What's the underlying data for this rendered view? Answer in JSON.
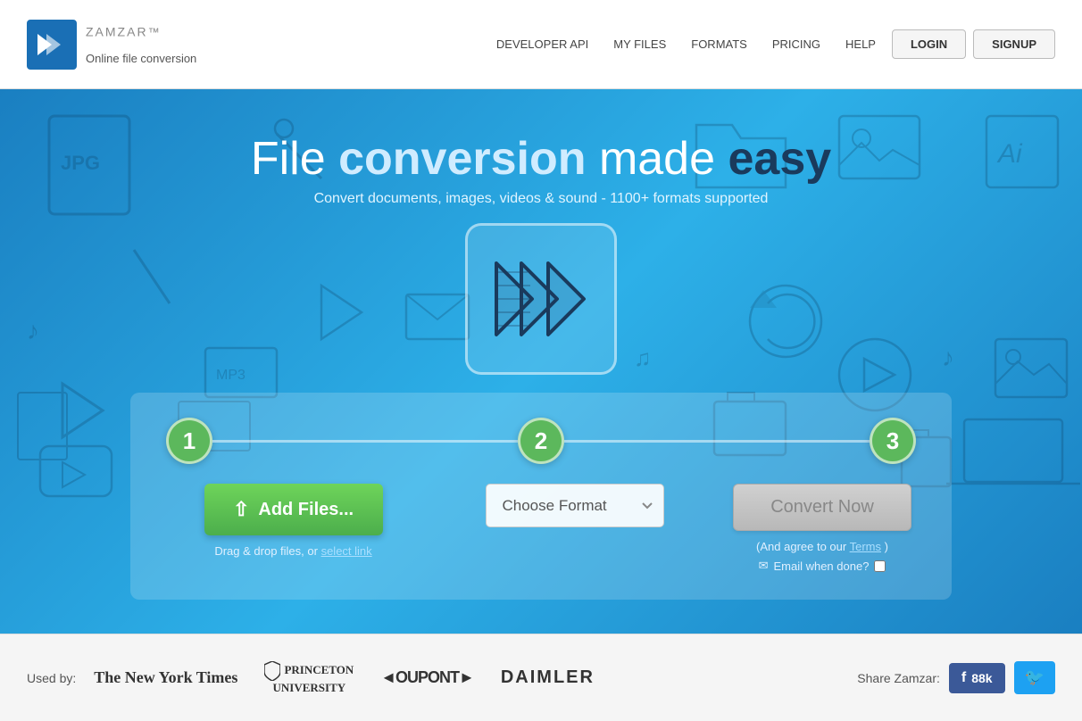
{
  "header": {
    "logo_brand": "ZAMZAR",
    "logo_trademark": "™",
    "logo_tagline": "Online file conversion",
    "nav_links": [
      {
        "label": "DEVELOPER API",
        "id": "developer-api"
      },
      {
        "label": "MY FILES",
        "id": "my-files"
      },
      {
        "label": "FORMATS",
        "id": "formats"
      },
      {
        "label": "PRICING",
        "id": "pricing"
      },
      {
        "label": "HELP",
        "id": "help"
      }
    ],
    "login_label": "LOGIN",
    "signup_label": "SIGNUP"
  },
  "hero": {
    "title_pre": "File ",
    "title_accent": "conversion",
    "title_mid": " made ",
    "title_bold": "easy",
    "subtitle": "Convert documents, images, videos & sound - 1100+ formats supported",
    "step1_number": "1",
    "step2_number": "2",
    "step3_number": "3",
    "add_files_label": "Add Files...",
    "drag_drop_text": "Drag & drop files, or",
    "select_link_label": "select link",
    "choose_format_label": "Choose Format",
    "convert_now_label": "Convert Now",
    "terms_text": "(And agree to our",
    "terms_link": "Terms",
    "terms_end": ")",
    "email_label": "Email when done?",
    "upload_icon": "↑"
  },
  "footer": {
    "used_by_label": "Used by:",
    "partners": [
      {
        "label": "The New York Times",
        "class": "partner-nyt"
      },
      {
        "label": "PRINCETON\nUNIVERSITY",
        "class": "partner-princeton"
      },
      {
        "label": "◄OUPONT►",
        "class": "partner-dupont"
      },
      {
        "label": "DAIMLER",
        "class": "partner-daimler"
      }
    ],
    "share_label": "Share Zamzar:",
    "fb_label": "f",
    "fb_count": "88k",
    "twitter_icon": "🐦"
  }
}
